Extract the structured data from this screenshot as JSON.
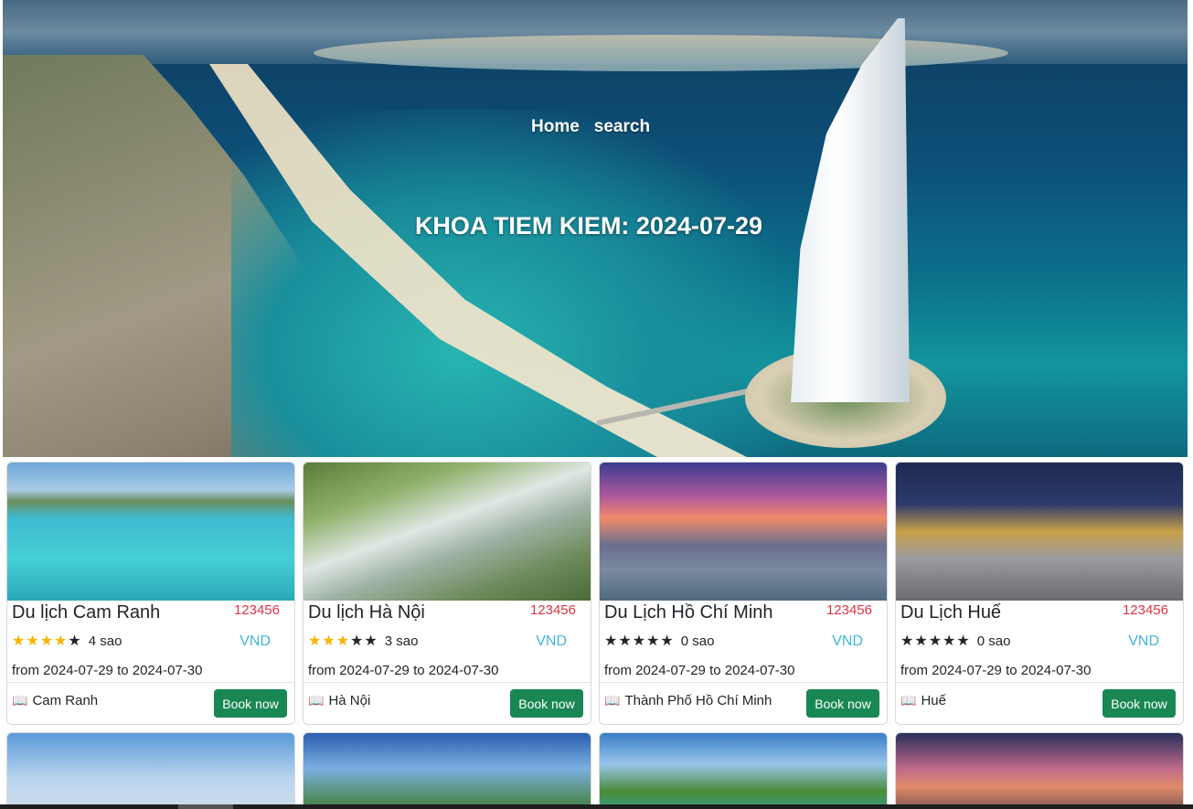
{
  "nav": {
    "home_label": "Home",
    "search_label": "search"
  },
  "hero": {
    "title": "KHOA TIEM KIEM: 2024-07-29"
  },
  "cards": [
    {
      "title": "Du lịch Cam Ranh",
      "price": "123456",
      "rating": 4,
      "stars_text": "4 sao",
      "currency": "VND",
      "dates": "from 2024-07-29 to 2024-07-30",
      "location": "Cam Ranh",
      "button": "Book now"
    },
    {
      "title": "Du lịch Hà Nội",
      "price": "123456",
      "rating": 3,
      "stars_text": "3 sao",
      "currency": "VND",
      "dates": "from 2024-07-29 to 2024-07-30",
      "location": "Hà Nội",
      "button": "Book now"
    },
    {
      "title": "Du Lịch Hồ Chí Minh",
      "price": "123456",
      "rating": 0,
      "stars_text": "0 sao",
      "currency": "VND",
      "dates": "from 2024-07-29 to 2024-07-30",
      "location": "Thành Phố Hồ Chí Minh",
      "button": "Book now"
    },
    {
      "title": "Du Lịch Huế",
      "price": "123456",
      "rating": 0,
      "stars_text": "0 sao",
      "currency": "VND",
      "dates": "from 2024-07-29 to 2024-07-30",
      "location": "Huế",
      "button": "Book now"
    }
  ],
  "colors": {
    "book_button": "#198754",
    "price": "#dc3545",
    "currency": "#40b6d9",
    "star_filled": "#f7b500"
  },
  "icons": {
    "star": "star-icon",
    "location": "book-open-icon"
  }
}
